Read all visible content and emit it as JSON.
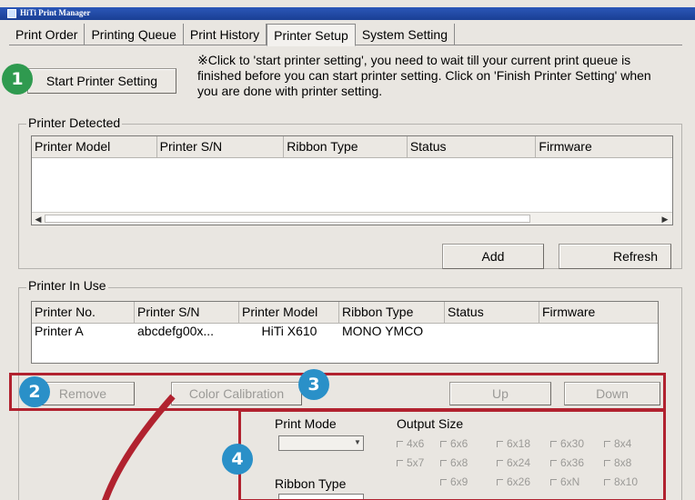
{
  "app": {
    "title": "HiTi Print Manager"
  },
  "tabs": [
    {
      "label": "Print Order",
      "active": false
    },
    {
      "label": "Printing Queue",
      "active": false
    },
    {
      "label": "Print History",
      "active": false
    },
    {
      "label": "Printer Setup",
      "active": true
    },
    {
      "label": "System Setting",
      "active": false
    }
  ],
  "setup": {
    "start_button": "Start Printer Setting",
    "note": "※Click to 'start printer setting', you need to wait till your current print queue is finished before you can start printer setting. Click on 'Finish Printer Setting' when you are done with printer setting."
  },
  "detected": {
    "label": "Printer Detected",
    "columns": [
      "Printer Model",
      "Printer S/N",
      "Ribbon Type",
      "Status",
      "Firmware"
    ],
    "add_button": "Add",
    "refresh_button": "Refresh"
  },
  "in_use": {
    "label": "Printer In Use",
    "columns": [
      "Printer No.",
      "Printer S/N",
      "Printer Model",
      "Ribbon Type",
      "Status",
      "Firmware"
    ],
    "rows": [
      {
        "no": "Printer A",
        "sn": "abcdefg00x...",
        "model": "HiTi X610",
        "ribbon": "MONO YMCO",
        "status": "",
        "firmware": ""
      }
    ]
  },
  "actions": {
    "remove": "Remove",
    "color_calibration": "Color Calibration",
    "up": "Up",
    "down": "Down"
  },
  "print_settings": {
    "print_mode_label": "Print Mode",
    "ribbon_type_label": "Ribbon Type",
    "output_size_label": "Output Size",
    "sizes": [
      "4x6",
      "6x6",
      "6x18",
      "6x30",
      "8x4",
      "5x7",
      "6x8",
      "6x24",
      "6x36",
      "8x8",
      "6x9",
      "6x26",
      "6xN",
      "8x10"
    ]
  },
  "annotations": {
    "badges": [
      "1",
      "2",
      "3",
      "4"
    ],
    "colors": {
      "green": "#2f9a4f",
      "blue": "#2a90c8",
      "red": "#b1222f"
    }
  }
}
